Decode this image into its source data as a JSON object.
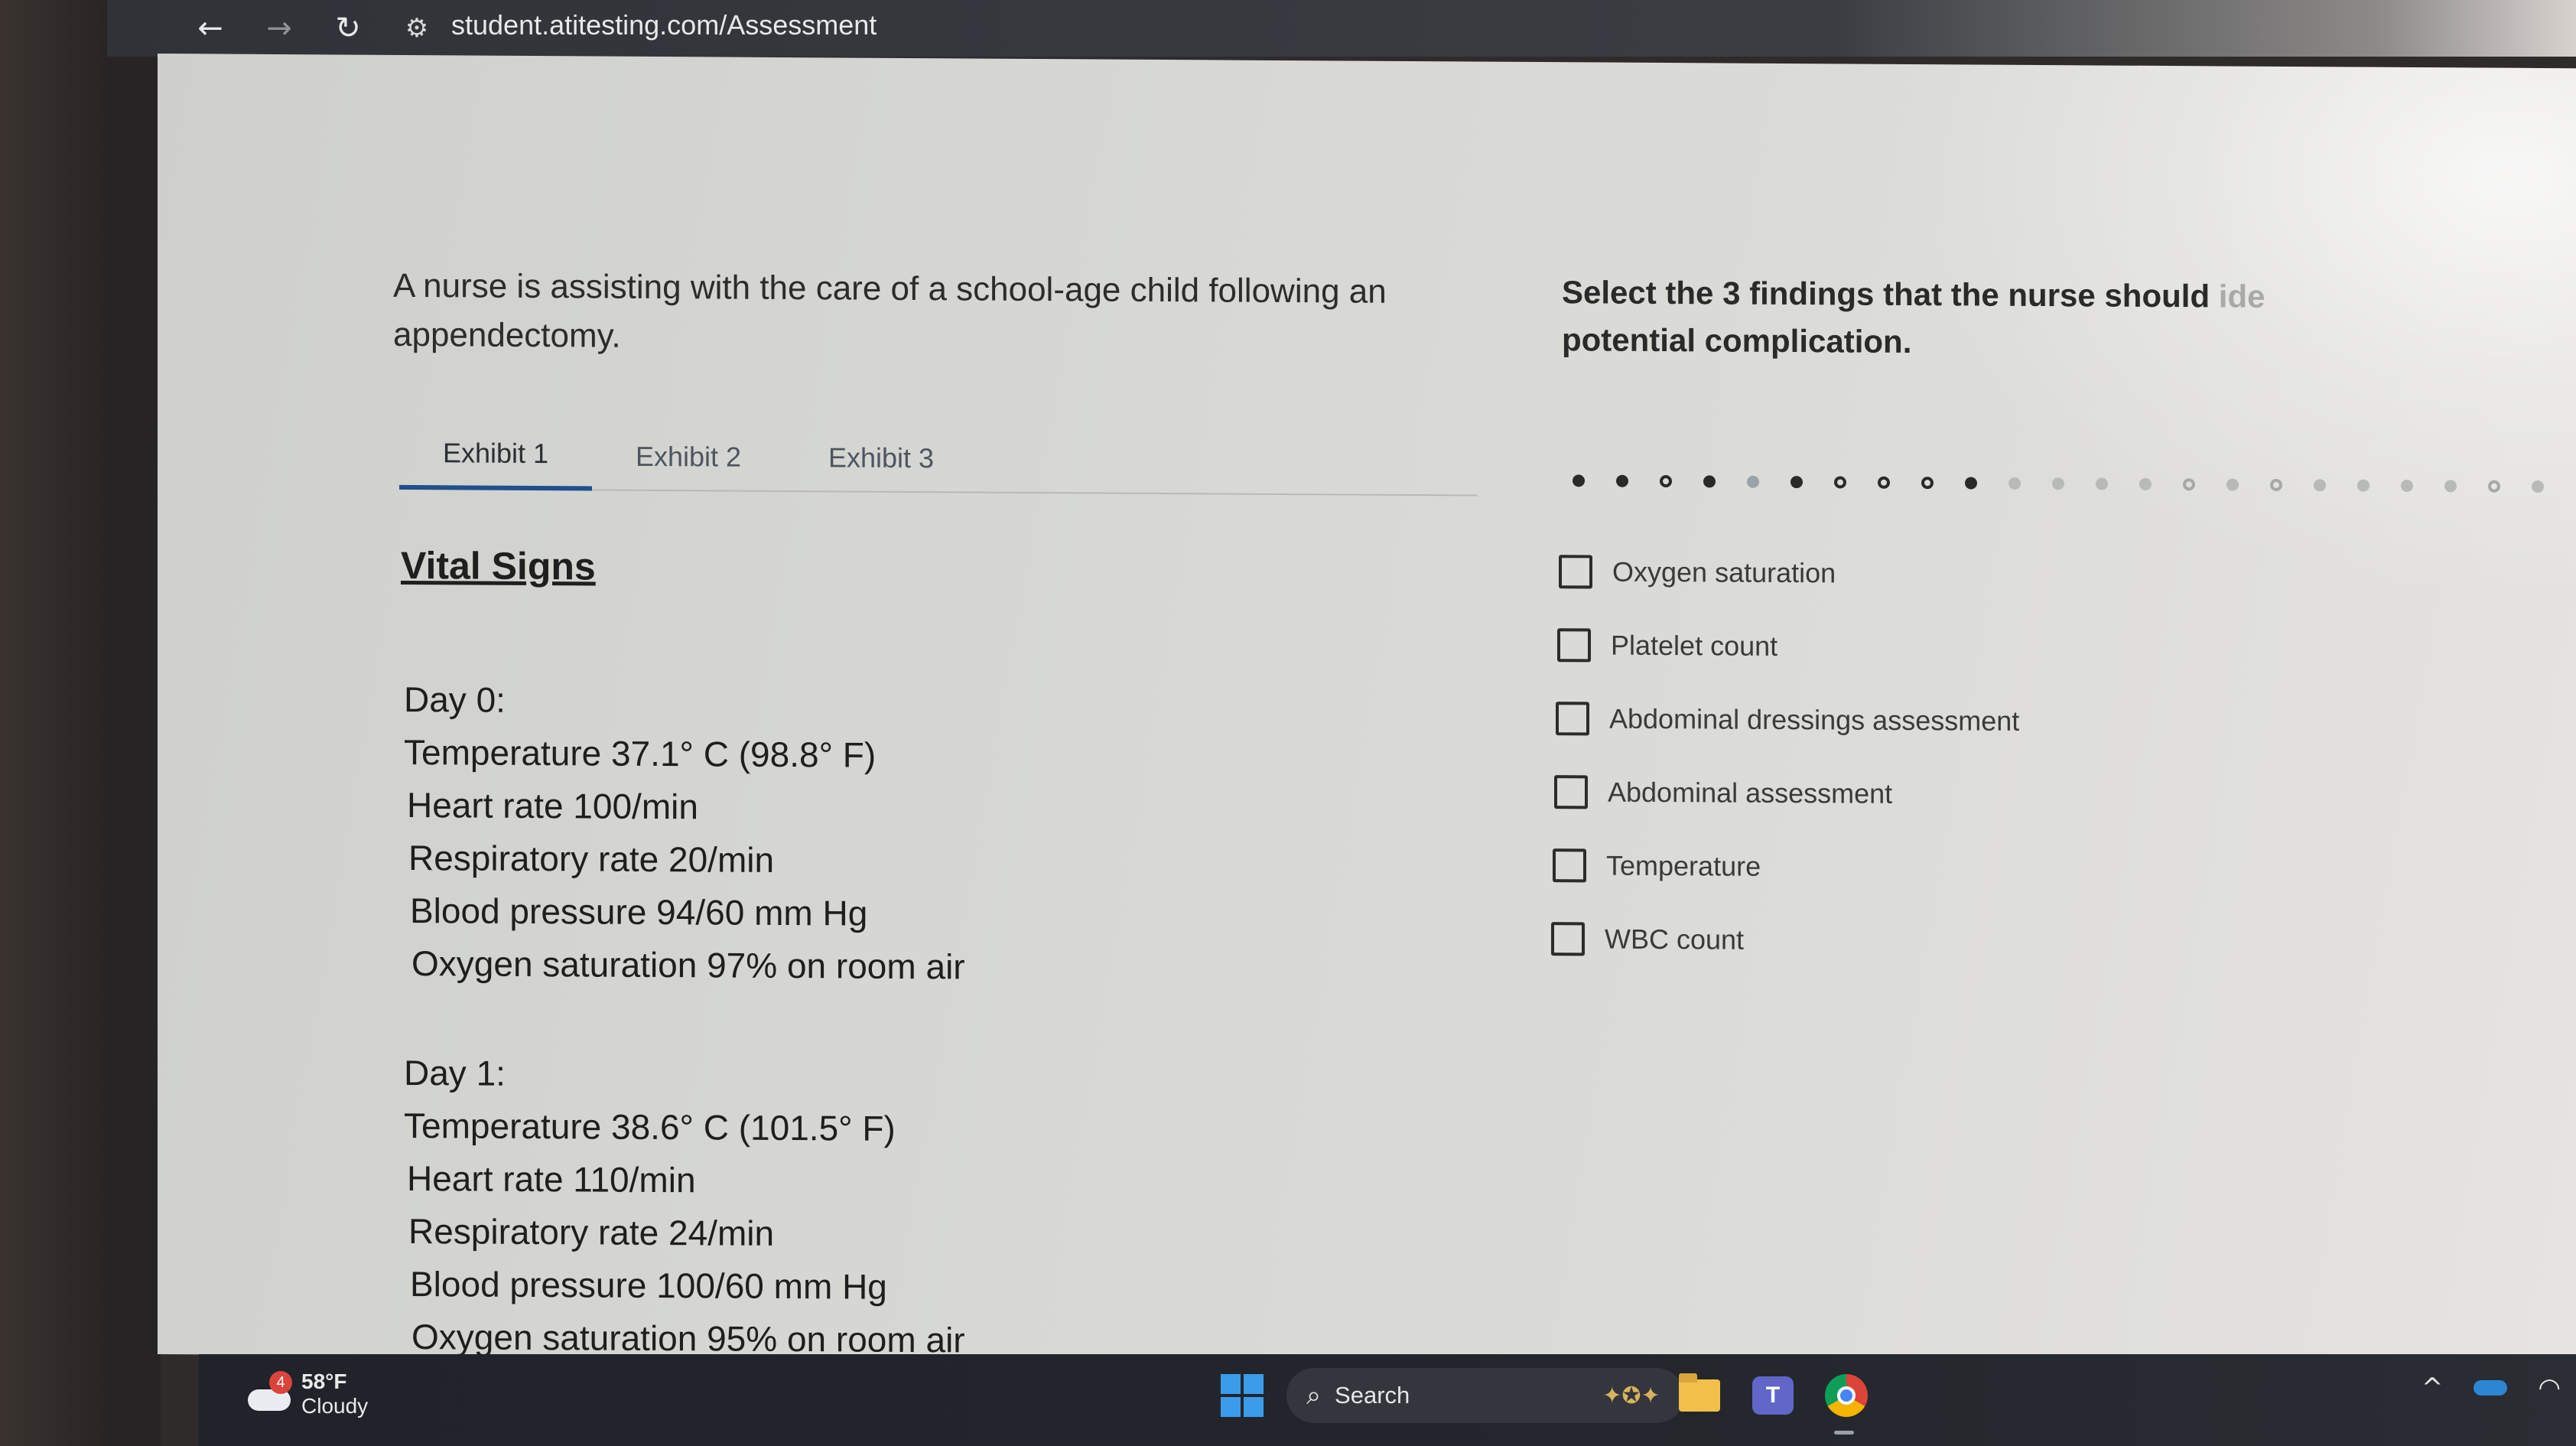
{
  "browser": {
    "back_icon": "←",
    "forward_icon": "→",
    "reload_icon": "↻",
    "site_info_icon": "⚙",
    "url": "student.atitesting.com/Assessment"
  },
  "question": {
    "stem": "A nurse is assisting with the care of a school-age child following an appendectomy."
  },
  "tabs": [
    {
      "label": "Exhibit 1",
      "active": true
    },
    {
      "label": "Exhibit 2",
      "active": false
    },
    {
      "label": "Exhibit 3",
      "active": false
    }
  ],
  "exhibit": {
    "title": "Vital Signs",
    "day0": {
      "heading": "Day 0:",
      "lines": [
        "Temperature 37.1° C (98.8° F)",
        "Heart rate 100/min",
        "Respiratory rate 20/min",
        "Blood pressure 94/60 mm Hg",
        "Oxygen saturation 97% on room air"
      ]
    },
    "day1": {
      "heading": "Day 1:",
      "lines": [
        "Temperature 38.6° C (101.5° F)",
        "Heart rate 110/min",
        "Respiratory rate 24/min",
        "Blood pressure 100/60 mm Hg",
        "Oxygen saturation 95% on room air"
      ]
    }
  },
  "instruction": {
    "visible": "Select the 3 findings that the nurse should",
    "faded": " ide",
    "line2": "potential complication."
  },
  "progress_dots": [
    "filled",
    "filled",
    "ring",
    "filled",
    "light",
    "filled",
    "ring",
    "ring",
    "ring",
    "filled",
    "pale",
    "pale",
    "pale",
    "pale",
    "pale-ring",
    "pale",
    "pale-ring",
    "pale",
    "pale",
    "pale",
    "pale",
    "pale-ring",
    "pale"
  ],
  "options": [
    {
      "label": "Oxygen saturation",
      "checked": false
    },
    {
      "label": "Platelet count",
      "checked": false
    },
    {
      "label": "Abdominal dressings assessment",
      "checked": false
    },
    {
      "label": "Abdominal assessment",
      "checked": false
    },
    {
      "label": "Temperature",
      "checked": false
    },
    {
      "label": "WBC count",
      "checked": false
    }
  ],
  "taskbar": {
    "weather": {
      "badge": "4",
      "temp": "58°F",
      "condition": "Cloudy"
    },
    "search_label": "Search",
    "teams_letter": "T",
    "tray": {
      "chevron": "^",
      "wifi_icon": "◠"
    }
  }
}
